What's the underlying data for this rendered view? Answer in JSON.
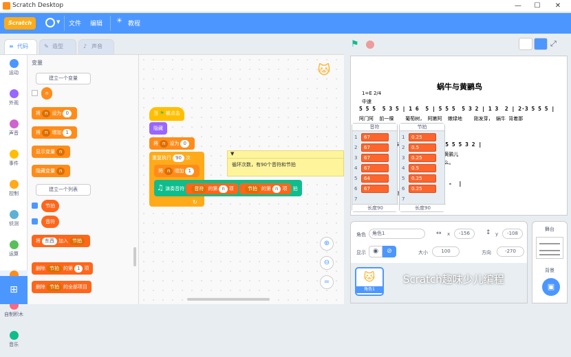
{
  "window": {
    "title": "Scratch Desktop",
    "controls": [
      "—",
      "☐",
      "✕"
    ]
  },
  "menu": {
    "logo": "Scratch",
    "file": "文件",
    "edit": "编辑",
    "tutorial": "教程"
  },
  "tabs": {
    "code": "代码",
    "costume": "造型",
    "sound": "声音"
  },
  "categories": [
    {
      "label": "运动",
      "color": "#4c97ff"
    },
    {
      "label": "外观",
      "color": "#9966ff"
    },
    {
      "label": "声音",
      "color": "#cf63cf"
    },
    {
      "label": "事件",
      "color": "#ffbf00"
    },
    {
      "label": "控制",
      "color": "#ffab19"
    },
    {
      "label": "侦测",
      "color": "#5cb1d6"
    },
    {
      "label": "运算",
      "color": "#59c059"
    },
    {
      "label": "变量",
      "color": "#ff8c1a"
    },
    {
      "label": "自制积木",
      "color": "#ff6680"
    },
    {
      "label": "音乐",
      "color": "#0fbd8c"
    }
  ],
  "palette": {
    "heading": "变量",
    "make_var": "建立一个变量",
    "var_n": "n",
    "set": "将",
    "set_to": "设为",
    "set_val": "0",
    "change": "将",
    "change_by": "增加",
    "change_val": "1",
    "show_var": "显示变量",
    "hide_var": "隐藏变量",
    "make_list": "建立一个列表",
    "list1": "节拍",
    "list2": "音符",
    "add": "将",
    "add_thing": "东西",
    "add_to": "加入",
    "add_list": "节拍",
    "del": "删除",
    "del_of": "的第",
    "del_idx": "1",
    "del_item": "项",
    "del_all": "的全部项目"
  },
  "script": {
    "flag": "当",
    "flag_clicked": "被点击",
    "hide": "隐藏",
    "set": "将",
    "n": "n",
    "set_to": "设为",
    "set_val": "0",
    "repeat": "重复执行",
    "repeat_n": "90",
    "repeat_times": "次",
    "change": "将",
    "change_by": "增加",
    "change_val": "1",
    "play": "演奏音符",
    "list_a": "音符",
    "of": "的第",
    "item": "项",
    "list_b": "节拍",
    "beat": "拍",
    "comment": "循环次数，有90个音符和节拍"
  },
  "stage": {
    "song_title": "蜗牛与黄鹂鸟",
    "key": "1=E  2/4",
    "tempo": "中速",
    "line1": "5 5 5  5 3 5 | 1 6  5 | 5 5 5  5 3 2 | 1 3  2 | 2·3 5 5 5 |",
    "lyric1": "阿门阿  前一棵    葡萄树， 阿嫩阿  嫩绿地    刚发芽， 蜗牛 背着那",
    "line2": "           6 | 5 6  5 | 5 5 5 5 3 2 |",
    "lyric2": "           爬 往上 爬，  阿黄阿 黄鹂儿",
    "lyric2b": "                        干  什么。",
    "line3": "         2 | 3  2 |  -  |  -  |",
    "lyric3": "         成  熟    了。",
    "list_notes": {
      "title": "音符",
      "items": [
        "67",
        "67",
        "67",
        "67",
        "64",
        "67"
      ],
      "idx": [
        "1",
        "2",
        "3",
        "4",
        "5",
        "6",
        "7"
      ],
      "length_label": "长度90"
    },
    "list_beats": {
      "title": "节拍",
      "items": [
        "0.25",
        "0.5",
        "0.25",
        "0.5",
        "0.25",
        "0.25"
      ],
      "idx": [
        "1",
        "2",
        "3",
        "4",
        "5",
        "6",
        "7"
      ],
      "length_label": "长度90"
    }
  },
  "sprite": {
    "label": "角色",
    "name": "角色1",
    "x_label": "x",
    "x": "-156",
    "y_label": "y",
    "y": "-108",
    "show_label": "显示",
    "size_label": "大小",
    "size": "100",
    "dir_label": "方向",
    "dir": "-270",
    "thumb_name": "角色1"
  },
  "stage_panel": {
    "label": "舞台",
    "backdrop_label": "背景"
  },
  "watermark": "Scratch趣味少儿编程"
}
